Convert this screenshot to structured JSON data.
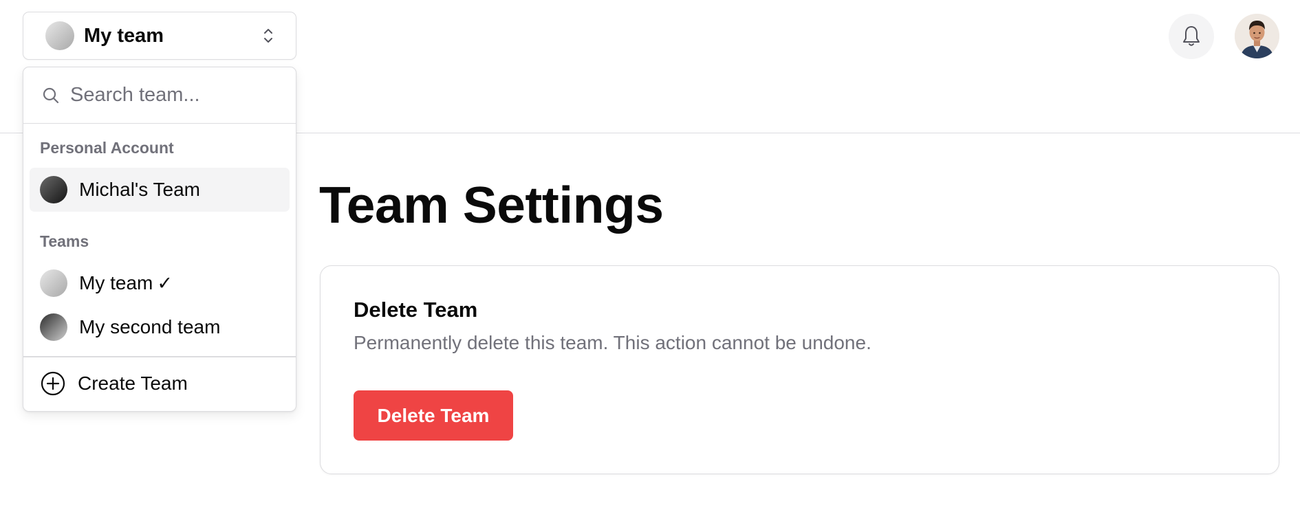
{
  "header": {
    "team_switcher": {
      "selected_team": "My team",
      "avatar_style": "gradient-light",
      "icon": "chevrons-up-down-icon"
    },
    "notifications_icon": "bell-icon",
    "user_avatar": "user-profile-photo"
  },
  "team_menu": {
    "search": {
      "placeholder": "Search team...",
      "value": "",
      "icon": "search-icon"
    },
    "personal_heading": "Personal Account",
    "personal_items": [
      {
        "label": "Michal's Team",
        "active": true,
        "avatar_style": "gradient-dark"
      }
    ],
    "teams_heading": "Teams",
    "team_items": [
      {
        "label": "My team",
        "selected": true,
        "check": "✓",
        "avatar_style": "gradient-light"
      },
      {
        "label": "My second team",
        "selected": false,
        "avatar_style": "gradient-dark-light"
      }
    ],
    "create": {
      "label": "Create Team",
      "icon": "plus-circle-icon"
    }
  },
  "main": {
    "title": "Team Settings",
    "danger_card": {
      "title": "Delete Team",
      "description": "Permanently delete this team. This action cannot be undone.",
      "button_label": "Delete Team"
    }
  },
  "colors": {
    "danger": "#ef4444",
    "border": "#dcdcdf",
    "muted_text": "#71717a",
    "active_item_bg": "#f4f4f5",
    "text": "#0a0a0a"
  }
}
